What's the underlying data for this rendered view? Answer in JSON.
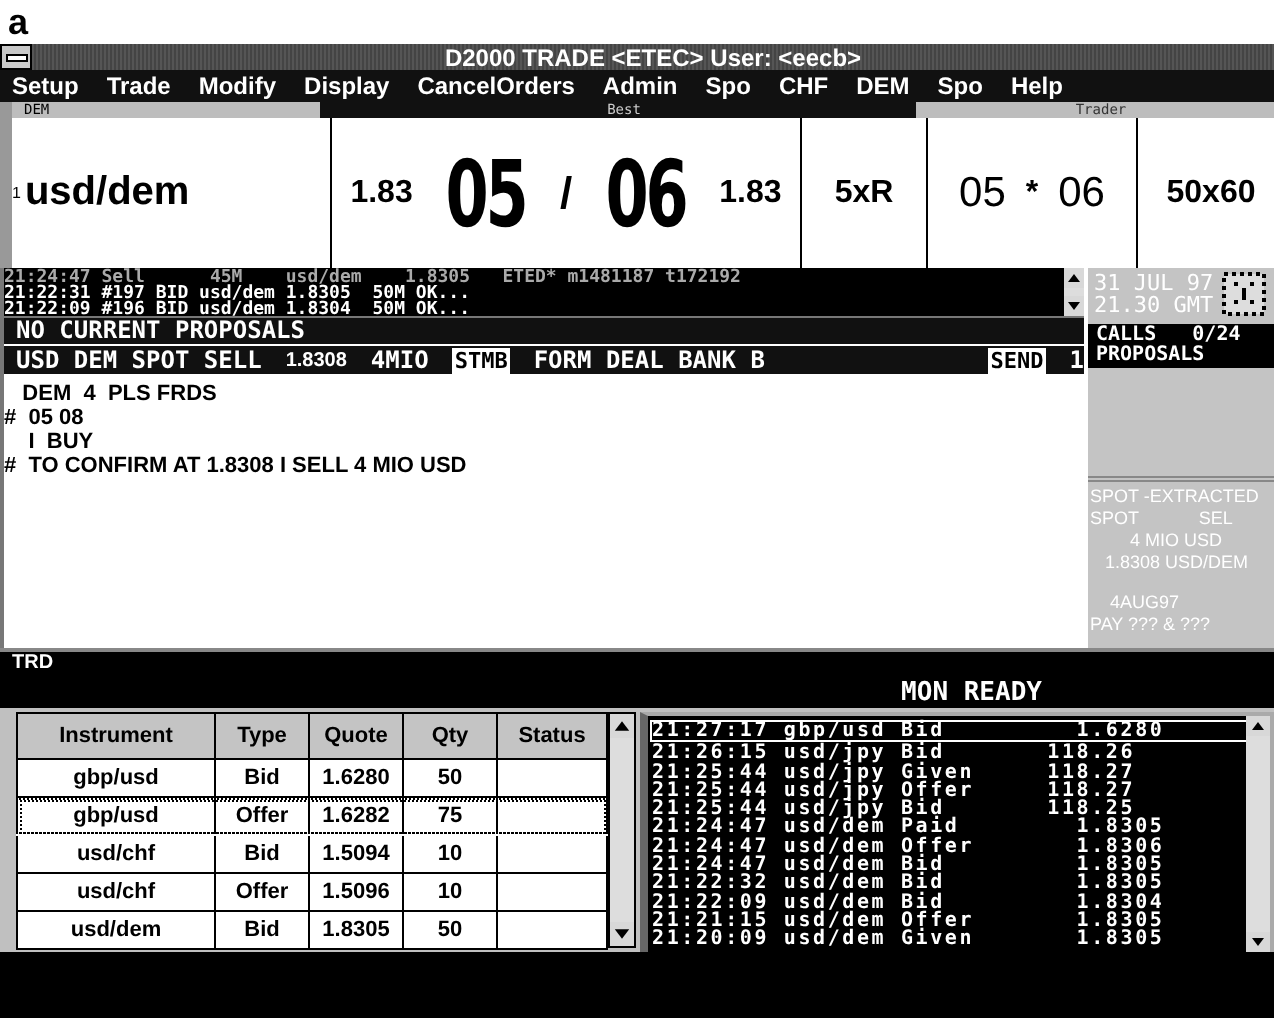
{
  "figure_label": "a",
  "window": {
    "title": "D2000 TRADE <ETEC> User: <eecb>"
  },
  "menu": [
    "Setup",
    "Trade",
    "Modify",
    "Display",
    "CancelOrders",
    "Admin",
    "Spo",
    "CHF",
    "DEM",
    "Spo",
    "Help"
  ],
  "quote_header": {
    "left": "DEM",
    "best": "Best",
    "trader": "Trader"
  },
  "quote_row": {
    "index": "1",
    "instrument": "usd/dem",
    "bid_big": "1.83",
    "bid": "05",
    "separator": "/",
    "offer": "06",
    "offer_big": "1.83",
    "size": "5xR",
    "trader_bid": "05",
    "trader_sep": "*",
    "trader_offer": "06",
    "trader_size": "50x60"
  },
  "log": [
    {
      "text": "21:24:47 Sell      45M    usd/dem    1.8305   ETED* m1481187 t172192",
      "dim": true
    },
    {
      "text": "21:22:31 #197 BID usd/dem 1.8305  50M OK...",
      "dim": false
    },
    {
      "text": "21:22:09 #196 BID usd/dem 1.8304  50M OK...",
      "dim": false
    }
  ],
  "proposals_bar": "NO CURRENT PROPOSALS",
  "deal_bar": {
    "instrument": "USD DEM SPOT SELL",
    "rate": "1.8308",
    "amount": "4MIO",
    "code": "STMB",
    "form": "FORM DEAL BANK B",
    "send": "SEND",
    "count": "1"
  },
  "messages": [
    "   DEM  4  PLS FRDS",
    "#  05 08",
    "    I  BUY",
    "#  TO CONFIRM AT 1.8308 I SELL 4 MIO USD"
  ],
  "side_panel": {
    "date": "31 JUL 97",
    "time": "21.30 GMT",
    "calls": "CALLS   0/24",
    "proposals": "PROPOSALS",
    "ticket": [
      "SPOT -EXTRACTED",
      "SPOT            SEL",
      "        4 MIO USD",
      "   1.8308 USD/DEM",
      "    4AUG97",
      "PAY ??? & ???"
    ]
  },
  "trd_bar": {
    "title": "TRD",
    "status": "MON READY"
  },
  "table": {
    "columns": [
      "Instrument",
      "Type",
      "Quote",
      "Qty",
      "Status"
    ],
    "rows": [
      {
        "cells": [
          "gbp/usd",
          "Bid",
          "1.6280",
          "50",
          ""
        ],
        "focused": false
      },
      {
        "cells": [
          "gbp/usd",
          "Offer",
          "1.6282",
          "75",
          ""
        ],
        "focused": true
      },
      {
        "cells": [
          "usd/chf",
          "Bid",
          "1.5094",
          "10",
          ""
        ],
        "focused": false
      },
      {
        "cells": [
          "usd/chf",
          "Offer",
          "1.5096",
          "10",
          ""
        ],
        "focused": false
      },
      {
        "cells": [
          "usd/dem",
          "Bid",
          "1.8305",
          "50",
          ""
        ],
        "focused": false
      }
    ]
  },
  "monitor": [
    {
      "text": "21:27:17 gbp/usd Bid         1.6280",
      "selected": true
    },
    {
      "text": "21:26:15 usd/jpy Bid       118.26",
      "selected": false
    },
    {
      "text": "21:25:44 usd/jpy Given     118.27",
      "selected": false
    },
    {
      "text": "21:25:44 usd/jpy Offer     118.27",
      "selected": false
    },
    {
      "text": "21:25:44 usd/jpy Bid       118.25",
      "selected": false
    },
    {
      "text": "21:24:47 usd/dem Paid        1.8305",
      "selected": false
    },
    {
      "text": "21:24:47 usd/dem Offer       1.8306",
      "selected": false
    },
    {
      "text": "21:24:47 usd/dem Bid         1.8305",
      "selected": false
    },
    {
      "text": "21:22:32 usd/dem Bid         1.8305",
      "selected": false
    },
    {
      "text": "21:22:09 usd/dem Bid         1.8304",
      "selected": false
    },
    {
      "text": "21:21:15 usd/dem Offer       1.8305",
      "selected": false
    },
    {
      "text": "21:20:09 usd/dem Given       1.8305",
      "selected": false
    }
  ]
}
